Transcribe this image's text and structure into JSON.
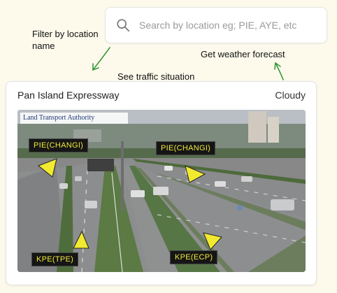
{
  "search": {
    "placeholder": "Search by location eg; PIE, AYE, etc",
    "value": "",
    "icon": "search-icon"
  },
  "annotations": {
    "filter": "Filter by location name",
    "weather": "Get weather forecast",
    "traffic": "See traffic situation"
  },
  "camera_card": {
    "title": "Pan Island Expressway",
    "weather": "Cloudy",
    "feed": {
      "logo_text": "Land Transport Authority",
      "labels": [
        "PIE(CHANGI)",
        "PIE(CHANGI)",
        "KPE(TPE)",
        "KPE(ECP)"
      ]
    }
  },
  "colors": {
    "background": "#fdfaec",
    "annotation_arrow": "#3a9a3a",
    "label_text": "#f1ea3a"
  }
}
